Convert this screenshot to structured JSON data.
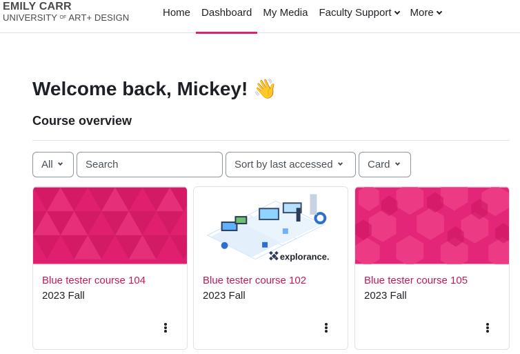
{
  "logo": {
    "line1": "EMILY CARR",
    "line2_pre": "UNIVERSITY ",
    "line2_of": "OF",
    "line2_post": " ART+ DESIGN"
  },
  "nav": {
    "home": "Home",
    "dashboard": "Dashboard",
    "my_media": "My Media",
    "faculty_support": "Faculty Support",
    "more": "More"
  },
  "accent_color": "#d6246e",
  "welcome": {
    "text": "Welcome back, Mickey! ",
    "emoji": "👋"
  },
  "course_overview": {
    "title": "Course overview",
    "filter": "All",
    "search_placeholder": "Search",
    "sort": "Sort by last accessed",
    "view": "Card"
  },
  "courses": [
    {
      "name": "Blue tester course 104",
      "term": "2023 Fall",
      "image": "pink-triangle-pattern"
    },
    {
      "name": "Blue tester course 102",
      "term": "2023 Fall",
      "image": "explorance-illustration",
      "image_text": "explorance."
    },
    {
      "name": "Blue tester course 105",
      "term": "2023 Fall",
      "image": "pink-octagon-pattern"
    }
  ]
}
